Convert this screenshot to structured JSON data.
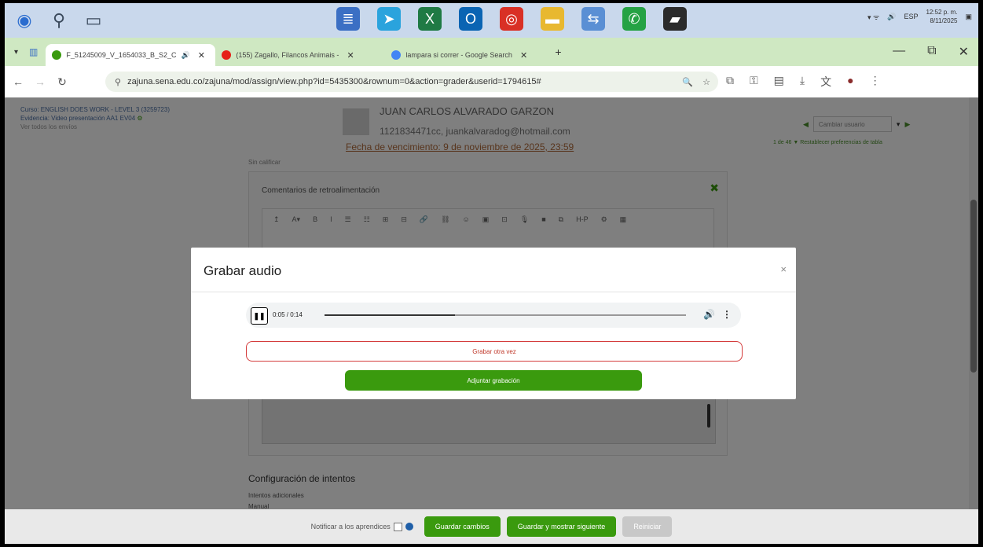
{
  "taskbar": {
    "left_icons": [
      {
        "name": "start-orb-icon",
        "color": "#2a6ccf"
      },
      {
        "name": "search-icon",
        "color": "#3b4a5c"
      },
      {
        "name": "task-view-icon",
        "color": "#3b4a5c"
      }
    ],
    "apps": [
      {
        "name": "notepad-icon",
        "color": "#3b6fc4"
      },
      {
        "name": "telegram-icon",
        "color": "#2aa3dd"
      },
      {
        "name": "excel-icon",
        "color": "#1f7a44"
      },
      {
        "name": "outlook-icon",
        "color": "#0a64b3"
      },
      {
        "name": "chrome-icon",
        "color": "#d93025"
      },
      {
        "name": "file-explorer-icon",
        "color": "#e8b830"
      },
      {
        "name": "network-app-icon",
        "color": "#5a8fd4"
      },
      {
        "name": "whatsapp-icon",
        "color": "#25a244"
      },
      {
        "name": "sticky-notes-icon",
        "color": "#2b2b2b"
      }
    ],
    "tray_lang": "ESP",
    "clock_time": "12:52 p. m.",
    "clock_date": "8/11/2025"
  },
  "tabs": [
    {
      "label": "F_51245009_V_1654033_B_S2_C",
      "favicon_color": "#3a9a0e",
      "active": true,
      "audio": "🔊"
    },
    {
      "label": "(155) Zagallo, Filancos Animais - ",
      "favicon_color": "#e62117",
      "active": false
    },
    {
      "label": "lampara si correr - Google Search",
      "favicon_color": "#4285f4",
      "active": false
    }
  ],
  "window_controls": {
    "minimize": "—",
    "restore": "⧉",
    "close": "✕"
  },
  "addressbar": {
    "url": "zajuna.sena.edu.co/zajuna/mod/assign/view.php?id=5435300&rownum=0&action=grader&userid=1794615#"
  },
  "page": {
    "course_line": "Curso: ENGLISH DOES WORK - LEVEL 3 (3259723)",
    "activity_line": "Evidencia: Video presentación AA1 EV04",
    "view_all": "Ver todos los envíos",
    "student_name": "JUAN CARLOS ALVARADO GARZON",
    "student_email": "1121834471cc, juankalvaradog@hotmail.com",
    "due_date": "Fecha de vencimiento: 9 de noviembre de 2025, 23:59",
    "change_user_label": "Cambiar usuario",
    "change_user_counter": "1 de 46",
    "reset_prefs": "Restablecer preferencias de tabla",
    "not_graded": "Sin calificar",
    "feedback_title": "Comentarios de retroalimentación",
    "toolbar_buttons": [
      "↥",
      "A▾",
      "B",
      "I",
      "☰",
      "☷",
      "⊞",
      "⊟",
      "🔗",
      "⛓",
      "☺",
      "▣",
      "⊡",
      "🎙",
      "■",
      "⧉",
      "H-P",
      "⚙",
      "▦"
    ],
    "config_title": "Configuración de intentos",
    "config_line1": "Intentos adicionales",
    "config_line2": "Manual"
  },
  "footer": {
    "notify_label": "Notificar a los aprendices",
    "save_changes": "Guardar cambios",
    "save_and_next": "Guardar y mostrar siguiente",
    "reset_button": "Reiniciar"
  },
  "modal": {
    "title": "Grabar audio",
    "close": "×",
    "player_time": "0:05 / 0:14",
    "progress": 0.36,
    "record_again": "Grabar otra vez",
    "attach": "Adjuntar grabación"
  }
}
